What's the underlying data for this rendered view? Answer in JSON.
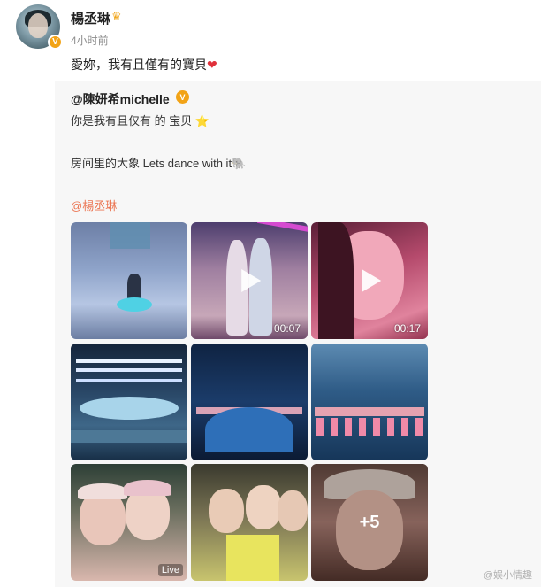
{
  "post": {
    "username": "楊丞琳",
    "crown_icon": "crown-icon",
    "time": "4小时前",
    "text": "愛妳，我有且僅有的寶貝",
    "text_emoji": "❤"
  },
  "repost": {
    "author": "@陳妍希michelle",
    "line1": "你是我有且仅有 的 宝贝",
    "line1_emoji": "⭐",
    "line2": "房间里的大象 Lets dance with it",
    "line2_emoji": "🐘",
    "mention": "@楊丞琳"
  },
  "media": [
    {
      "kind": "photo"
    },
    {
      "kind": "video",
      "duration": "00:07"
    },
    {
      "kind": "video",
      "duration": "00:17"
    },
    {
      "kind": "photo"
    },
    {
      "kind": "photo"
    },
    {
      "kind": "photo"
    },
    {
      "kind": "live",
      "badge": "Live"
    },
    {
      "kind": "photo"
    },
    {
      "kind": "photo",
      "more": "+5"
    }
  ],
  "watermark": "@娱小情趣",
  "colors": {
    "mention": "#eb7350",
    "verified": "#f2a316",
    "repost_bg": "#f7f7f7"
  }
}
